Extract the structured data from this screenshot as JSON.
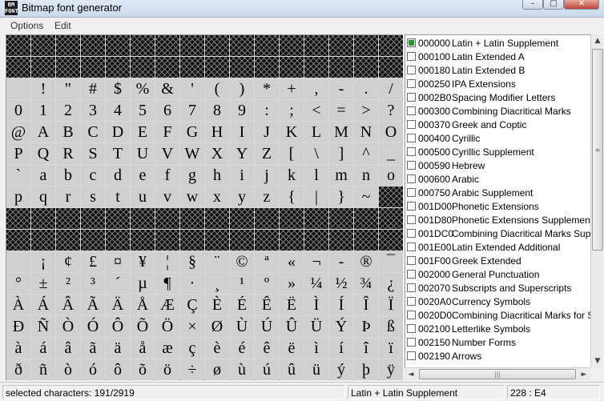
{
  "window": {
    "title": "Bitmap font generator",
    "icon_text": "BM FONT",
    "min_glyph": "–",
    "max_glyph": "□",
    "close_glyph": "✕"
  },
  "menu": {
    "options": "Options",
    "edit": "Edit"
  },
  "glyph_rows": [
    [
      "",
      "",
      "",
      "",
      "",
      "",
      "",
      "",
      "",
      "",
      "",
      "",
      "",
      "",
      "",
      ""
    ],
    [
      "",
      "",
      "",
      "",
      "",
      "",
      "",
      "",
      "",
      "",
      "",
      "",
      "",
      "",
      "",
      ""
    ],
    [
      " ",
      "!",
      "\"",
      "#",
      "$",
      "%",
      "&",
      "'",
      "(",
      ")",
      "*",
      "+",
      ",",
      "-",
      ".",
      "/"
    ],
    [
      "0",
      "1",
      "2",
      "3",
      "4",
      "5",
      "6",
      "7",
      "8",
      "9",
      ":",
      ";",
      "<",
      "=",
      ">",
      "?"
    ],
    [
      "@",
      "A",
      "B",
      "C",
      "D",
      "E",
      "F",
      "G",
      "H",
      "I",
      "J",
      "K",
      "L",
      "M",
      "N",
      "O"
    ],
    [
      "P",
      "Q",
      "R",
      "S",
      "T",
      "U",
      "V",
      "W",
      "X",
      "Y",
      "Z",
      "[",
      "\\",
      "]",
      "^",
      "_"
    ],
    [
      "`",
      "a",
      "b",
      "c",
      "d",
      "e",
      "f",
      "g",
      "h",
      "i",
      "j",
      "k",
      "l",
      "m",
      "n",
      "o"
    ],
    [
      "p",
      "q",
      "r",
      "s",
      "t",
      "u",
      "v",
      "w",
      "x",
      "y",
      "z",
      "{",
      "|",
      "}",
      "~",
      ""
    ],
    [
      "",
      "",
      "",
      "",
      "",
      "",
      "",
      "",
      "",
      "",
      "",
      "",
      "",
      "",
      "",
      ""
    ],
    [
      "",
      "",
      "",
      "",
      "",
      "",
      "",
      "",
      "",
      "",
      "",
      "",
      "",
      "",
      "",
      ""
    ],
    [
      " ",
      "¡",
      "¢",
      "£",
      "¤",
      "¥",
      "¦",
      "§",
      "¨",
      "©",
      "ª",
      "«",
      "¬",
      "-",
      "®",
      "¯"
    ],
    [
      "°",
      "±",
      "²",
      "³",
      "´",
      "µ",
      "¶",
      "·",
      "¸",
      "¹",
      "º",
      "»",
      "¼",
      "½",
      "¾",
      "¿"
    ],
    [
      "À",
      "Á",
      "Â",
      "Ã",
      "Ä",
      "Å",
      "Æ",
      "Ç",
      "È",
      "É",
      "Ê",
      "Ë",
      "Ì",
      "Í",
      "Î",
      "Ï"
    ],
    [
      "Ð",
      "Ñ",
      "Ò",
      "Ó",
      "Ô",
      "Õ",
      "Ö",
      "×",
      "Ø",
      "Ù",
      "Ú",
      "Û",
      "Ü",
      "Ý",
      "Þ",
      "ß"
    ],
    [
      "à",
      "á",
      "â",
      "ã",
      "ä",
      "å",
      "æ",
      "ç",
      "è",
      "é",
      "ê",
      "ë",
      "ì",
      "í",
      "î",
      "ï"
    ],
    [
      "ð",
      "ñ",
      "ò",
      "ó",
      "ô",
      "õ",
      "ö",
      "÷",
      "ø",
      "ù",
      "ú",
      "û",
      "ü",
      "ý",
      "þ",
      "ÿ"
    ]
  ],
  "unavailable_rows": [
    [
      1,
      1,
      1,
      1,
      1,
      1,
      1,
      1,
      1,
      1,
      1,
      1,
      1,
      1,
      1,
      1
    ],
    [
      1,
      1,
      1,
      1,
      1,
      1,
      1,
      1,
      1,
      1,
      1,
      1,
      1,
      1,
      1,
      1
    ],
    [
      0,
      0,
      0,
      0,
      0,
      0,
      0,
      0,
      0,
      0,
      0,
      0,
      0,
      0,
      0,
      0
    ],
    [
      0,
      0,
      0,
      0,
      0,
      0,
      0,
      0,
      0,
      0,
      0,
      0,
      0,
      0,
      0,
      0
    ],
    [
      0,
      0,
      0,
      0,
      0,
      0,
      0,
      0,
      0,
      0,
      0,
      0,
      0,
      0,
      0,
      0
    ],
    [
      0,
      0,
      0,
      0,
      0,
      0,
      0,
      0,
      0,
      0,
      0,
      0,
      0,
      0,
      0,
      0
    ],
    [
      0,
      0,
      0,
      0,
      0,
      0,
      0,
      0,
      0,
      0,
      0,
      0,
      0,
      0,
      0,
      0
    ],
    [
      0,
      0,
      0,
      0,
      0,
      0,
      0,
      0,
      0,
      0,
      0,
      0,
      0,
      0,
      0,
      1
    ],
    [
      1,
      1,
      1,
      1,
      1,
      1,
      1,
      1,
      1,
      1,
      1,
      1,
      1,
      1,
      1,
      1
    ],
    [
      1,
      1,
      1,
      1,
      1,
      1,
      1,
      1,
      1,
      1,
      1,
      1,
      1,
      1,
      1,
      1
    ],
    [
      0,
      0,
      0,
      0,
      0,
      0,
      0,
      0,
      0,
      0,
      0,
      0,
      0,
      0,
      0,
      0
    ],
    [
      0,
      0,
      0,
      0,
      0,
      0,
      0,
      0,
      0,
      0,
      0,
      0,
      0,
      0,
      0,
      0
    ],
    [
      0,
      0,
      0,
      0,
      0,
      0,
      0,
      0,
      0,
      0,
      0,
      0,
      0,
      0,
      0,
      0
    ],
    [
      0,
      0,
      0,
      0,
      0,
      0,
      0,
      0,
      0,
      0,
      0,
      0,
      0,
      0,
      0,
      0
    ],
    [
      0,
      0,
      0,
      0,
      0,
      0,
      0,
      0,
      0,
      0,
      0,
      0,
      0,
      0,
      0,
      0
    ],
    [
      0,
      0,
      0,
      0,
      0,
      0,
      0,
      0,
      0,
      0,
      0,
      0,
      0,
      0,
      0,
      0
    ]
  ],
  "ranges": [
    {
      "code": "000000",
      "name": "Latin + Latin Supplement",
      "checked": true
    },
    {
      "code": "000100",
      "name": "Latin Extended A",
      "checked": false
    },
    {
      "code": "000180",
      "name": "Latin Extended B",
      "checked": false
    },
    {
      "code": "000250",
      "name": "IPA Extensions",
      "checked": false
    },
    {
      "code": "0002B0",
      "name": "Spacing Modifier Letters",
      "checked": false
    },
    {
      "code": "000300",
      "name": "Combining Diacritical Marks",
      "checked": false
    },
    {
      "code": "000370",
      "name": "Greek and Coptic",
      "checked": false
    },
    {
      "code": "000400",
      "name": "Cyrillic",
      "checked": false
    },
    {
      "code": "000500",
      "name": "Cyrillic Supplement",
      "checked": false
    },
    {
      "code": "000590",
      "name": "Hebrew",
      "checked": false
    },
    {
      "code": "000600",
      "name": "Arabic",
      "checked": false
    },
    {
      "code": "000750",
      "name": "Arabic Supplement",
      "checked": false
    },
    {
      "code": "001D00",
      "name": "Phonetic Extensions",
      "checked": false
    },
    {
      "code": "001D80",
      "name": "Phonetic Extensions Supplement",
      "checked": false
    },
    {
      "code": "001DC0",
      "name": "Combining Diacritical Marks Supplement",
      "checked": false
    },
    {
      "code": "001E00",
      "name": "Latin Extended Additional",
      "checked": false
    },
    {
      "code": "001F00",
      "name": "Greek Extended",
      "checked": false
    },
    {
      "code": "002000",
      "name": "General Punctuation",
      "checked": false
    },
    {
      "code": "002070",
      "name": "Subscripts and Superscripts",
      "checked": false
    },
    {
      "code": "0020A0",
      "name": "Currency Symbols",
      "checked": false
    },
    {
      "code": "0020D0",
      "name": "Combining Diacritical Marks for Symbols",
      "checked": false
    },
    {
      "code": "002100",
      "name": "Letterlike Symbols",
      "checked": false
    },
    {
      "code": "002150",
      "name": "Number Forms",
      "checked": false
    },
    {
      "code": "002190",
      "name": "Arrows",
      "checked": false
    }
  ],
  "scroll": {
    "up": "▲",
    "down": "▼",
    "left": "◄",
    "right": "►",
    "grip_v": "≡",
    "grip_h": "|||"
  },
  "status": {
    "selected": "selected characters: 191/2919",
    "range": "Latin + Latin Supplement",
    "char": "228 : E4"
  },
  "colors": {
    "checked_box": "#1f9c2d",
    "unavailable_cell": "#0d0d0d",
    "cell_bg": "#d0d0d0"
  }
}
